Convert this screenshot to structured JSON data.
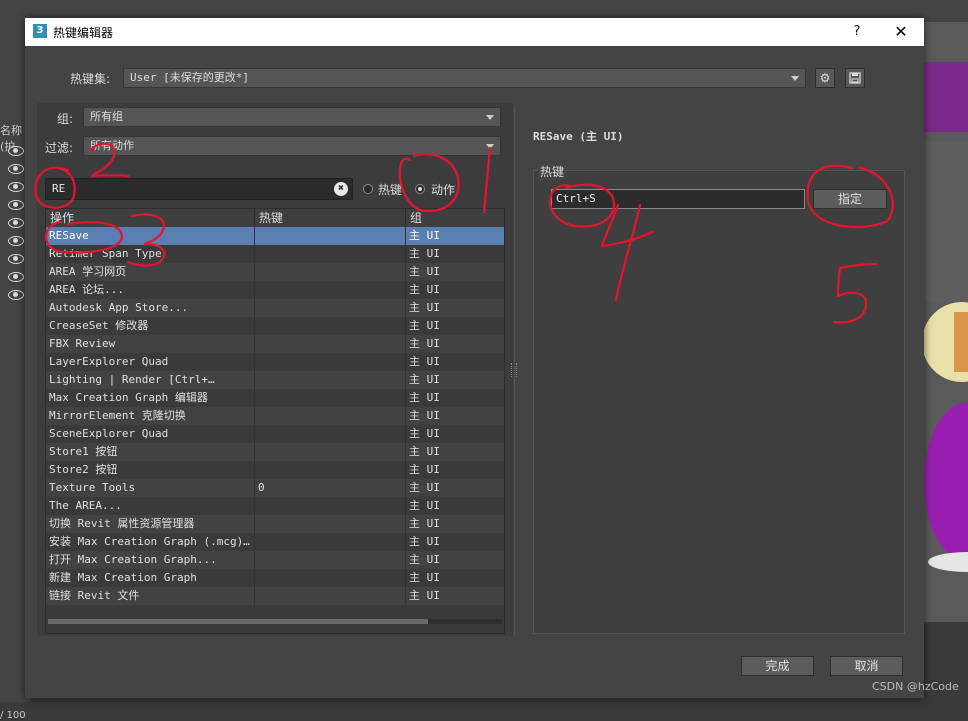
{
  "dialog": {
    "title": "热键编辑器",
    "app_icon_text": "3",
    "help_label": "?",
    "close_label": "✕"
  },
  "hotkey_set": {
    "label": "热键集:",
    "value": "User [未保存的更改*]"
  },
  "group_filter": {
    "label": "组:",
    "value": "所有组"
  },
  "action_filter": {
    "label": "过滤:",
    "value": "所有动作"
  },
  "search": {
    "value": "RE",
    "clear_symbol": "✖",
    "radio_hotkey_label": "热键",
    "radio_action_label": "动作",
    "selected_mode": "action"
  },
  "table": {
    "headers": [
      "操作",
      "热键",
      "组"
    ],
    "rows": [
      {
        "action": "RESave",
        "hotkey": "",
        "group": "主 UI",
        "selected": true
      },
      {
        "action": "Retimer Span Type",
        "hotkey": "",
        "group": "主 UI"
      },
      {
        "action": "AREA 学习网页",
        "hotkey": "",
        "group": "主 UI"
      },
      {
        "action": "AREA 论坛...",
        "hotkey": "",
        "group": "主 UI"
      },
      {
        "action": "Autodesk App Store...",
        "hotkey": "",
        "group": "主 UI"
      },
      {
        "action": "CreaseSet 修改器",
        "hotkey": "",
        "group": "主 UI"
      },
      {
        "action": "FBX Review",
        "hotkey": "",
        "group": "主 UI"
      },
      {
        "action": "LayerExplorer Quad",
        "hotkey": "",
        "group": "主 UI"
      },
      {
        "action": "Lighting | Render      [Ctrl+…",
        "hotkey": "",
        "group": "主 UI"
      },
      {
        "action": "Max Creation Graph  编辑器",
        "hotkey": "",
        "group": "主 UI"
      },
      {
        "action": "MirrorElement 克隆切换",
        "hotkey": "",
        "group": "主 UI"
      },
      {
        "action": "SceneExplorer Quad",
        "hotkey": "",
        "group": "主 UI"
      },
      {
        "action": "Store1 按钮",
        "hotkey": "",
        "group": "主 UI"
      },
      {
        "action": "Store2 按钮",
        "hotkey": "",
        "group": "主 UI"
      },
      {
        "action": "Texture Tools",
        "hotkey": "0",
        "group": "主 UI"
      },
      {
        "action": "The AREA...",
        "hotkey": "",
        "group": "主 UI"
      },
      {
        "action": "切换 Revit 属性资源管理器",
        "hotkey": "",
        "group": "主 UI"
      },
      {
        "action": "安装 Max Creation Graph (.mcg)…",
        "hotkey": "",
        "group": "主 UI"
      },
      {
        "action": "打开 Max Creation Graph...",
        "hotkey": "",
        "group": "主 UI"
      },
      {
        "action": "新建 Max Creation Graph",
        "hotkey": "",
        "group": "主 UI"
      },
      {
        "action": "链接 Revit 文件",
        "hotkey": "",
        "group": "主 UI"
      }
    ]
  },
  "detail": {
    "heading": "RESave (主 UI)",
    "group_label": "热键",
    "hotkey_value": "Ctrl+S",
    "assign_label": "指定"
  },
  "footer": {
    "ok_label": "完成",
    "cancel_label": "取消"
  },
  "background": {
    "left_label": "名称(护",
    "bottom_left": "/ 100"
  },
  "annotations": [
    "1",
    "2",
    "3",
    "4",
    "5"
  ],
  "watermark": "CSDN @hzCode",
  "colors": {
    "selection": "#5a7fb0",
    "ink": "#e8132f",
    "dialog_bg": "#444444"
  }
}
